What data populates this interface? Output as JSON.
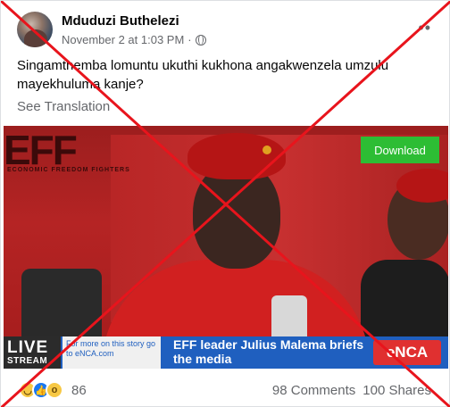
{
  "post": {
    "author": "Mduduzi Buthelezi",
    "timestamp": "November 2 at 1:03 PM",
    "separator": "·",
    "text": "Singamthemba lomuntu ukuthi kukhona angakwenzela umzulu mayekhuluma kanje?",
    "see_translation": "See Translation"
  },
  "video": {
    "download_label": "Download",
    "eff_logo_text": "EFF",
    "eff_logo_sub": "ECONOMIC FREEDOM FIGHTERS",
    "live_label": "LIVE",
    "stream_label": "STREAM",
    "more_info_text": "For more on this story go to eNCA.com",
    "headline": "EFF leader Julius Malema briefs the media",
    "channel": "eNCA"
  },
  "footer": {
    "reactions": [
      "haha-icon",
      "like-icon",
      "wow-icon"
    ],
    "reaction_count": "86",
    "comments": "98 Comments",
    "shares": "100 Shares"
  },
  "overlay": {
    "cross_color": "#e8141c"
  },
  "colors": {
    "download_green": "#2dbd34",
    "ticker_blue": "#1f5fbf",
    "enca_red": "#e03030",
    "meta_grey": "#65676b"
  }
}
